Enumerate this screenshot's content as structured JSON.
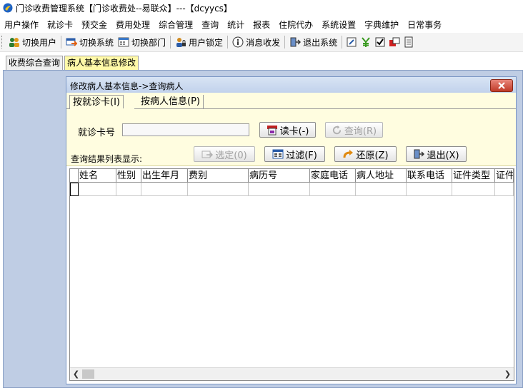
{
  "window": {
    "title": "门诊收费管理系统【门诊收费处--易联众】---【dcyycs】"
  },
  "menu": [
    "用户操作",
    "就诊卡",
    "预交金",
    "费用处理",
    "综合管理",
    "查询",
    "统计",
    "报表",
    "住院代办",
    "系统设置",
    "字典维护",
    "日常事务"
  ],
  "toolbar": {
    "switch_user": "切换用户",
    "switch_system": "切换系统",
    "switch_dept": "切换部门",
    "lock_user": "用户锁定",
    "message": "消息收发",
    "exit_system": "退出系统"
  },
  "doc_tabs": [
    {
      "label": "收费综合查询",
      "active": false
    },
    {
      "label": "病人基本信息修改",
      "active": true
    }
  ],
  "dialog": {
    "title": "修改病人基本信息->查询病人",
    "tabs": [
      {
        "label": "按就诊卡(I)",
        "active": true
      },
      {
        "label": "按病人信息(P)",
        "active": false
      }
    ],
    "card_label": "就诊卡号",
    "card_value": "",
    "read_card_label": "读卡(-)",
    "query_label": "查询(R)",
    "result_label": "查询结果列表显示:",
    "select_label": "选定(0)",
    "filter_label": "过滤(F)",
    "restore_label": "还原(Z)",
    "exit_label": "退出(X)"
  },
  "grid": {
    "columns": [
      "姓名",
      "性别",
      "出生年月",
      "费别",
      "病历号",
      "家庭电话",
      "病人地址",
      "联系电话",
      "证件类型",
      "证件"
    ]
  }
}
